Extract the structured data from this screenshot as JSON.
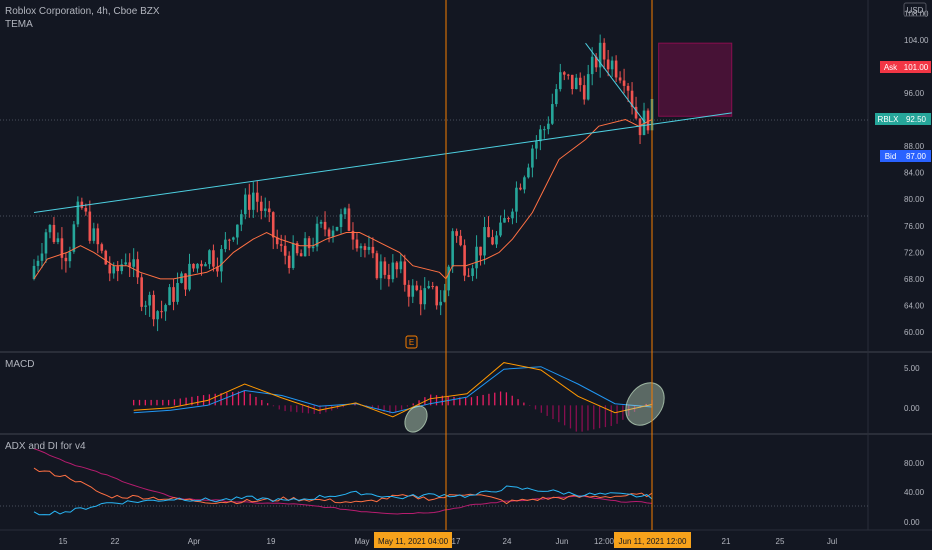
{
  "header": {
    "symbol": "Roblox Corporation, 4h, Cboe BZX",
    "indicator": "TEMA",
    "currency_badge": "USD"
  },
  "price_axis": {
    "ticks": [
      "108.00",
      "104.00",
      "100.00",
      "96.00",
      "92.00",
      "88.00",
      "84.00",
      "80.00",
      "76.00",
      "72.00",
      "68.00",
      "64.00",
      "60.00"
    ],
    "range": [
      57,
      110
    ]
  },
  "tags": {
    "ask": {
      "label": "Ask",
      "value": "101.00",
      "color": "#f23645"
    },
    "last": {
      "label": "RBLX",
      "value": "92.50",
      "color": "#26a69a"
    },
    "bid": {
      "label": "Bid",
      "value": "87.00",
      "color": "#2962ff"
    }
  },
  "earnings_marker": "E",
  "panes": {
    "macd": {
      "title": "MACD",
      "ticks": [
        "5.00",
        "0.00"
      ]
    },
    "adx": {
      "title": "ADX and DI for v4",
      "ticks": [
        "80.00",
        "40.00",
        "0.00"
      ]
    }
  },
  "time_axis": {
    "labels": [
      "15",
      "22",
      "Apr",
      "19",
      "May",
      "17",
      "24",
      "Jun",
      "12:00",
      "21",
      "25",
      "Jul"
    ],
    "highlight_left": "May 11, 2021   04:00",
    "highlight_right": "Jun 11, 2021   12:00"
  },
  "chart_data": {
    "type": "candlestick",
    "title": "Roblox Corporation, 4h, Cboe BZX",
    "ylim": [
      57,
      110
    ],
    "x": [
      "2021-03-10",
      "2021-03-12",
      "2021-03-15",
      "2021-03-17",
      "2021-03-19",
      "2021-03-22",
      "2021-03-24",
      "2021-03-26",
      "2021-03-29",
      "2021-03-31",
      "2021-04-05",
      "2021-04-07",
      "2021-04-09",
      "2021-04-12",
      "2021-04-14",
      "2021-04-16",
      "2021-04-19",
      "2021-04-21",
      "2021-04-23",
      "2021-04-26",
      "2021-04-28",
      "2021-04-30",
      "2021-05-04",
      "2021-05-06",
      "2021-05-10",
      "2021-05-11",
      "2021-05-12",
      "2021-05-14",
      "2021-05-17",
      "2021-05-19",
      "2021-05-21",
      "2021-05-24",
      "2021-05-26",
      "2021-05-28",
      "2021-06-01",
      "2021-06-03",
      "2021-06-07",
      "2021-06-09",
      "2021-06-11"
    ],
    "close": [
      70,
      76,
      72,
      79,
      74,
      68,
      72,
      66,
      63,
      66,
      72,
      71,
      76,
      81,
      77,
      72,
      71,
      74,
      76,
      77,
      74,
      70,
      69,
      66,
      65,
      66,
      76,
      70,
      74,
      74,
      80,
      88,
      91,
      98,
      97,
      102,
      99,
      91,
      93
    ],
    "series": [
      {
        "name": "TEMA",
        "values": [
          68,
          71,
          72,
          73,
          72,
          70,
          70,
          69,
          68,
          68,
          69,
          70,
          72,
          74,
          75,
          74,
          73,
          73,
          74,
          75,
          75,
          74,
          72,
          70,
          69,
          68,
          70,
          70,
          71,
          72,
          74,
          78,
          82,
          86,
          89,
          91,
          92,
          91,
          92
        ]
      }
    ],
    "annotations": [
      {
        "type": "trendline",
        "from": [
          "2021-03-10",
          78
        ],
        "to": [
          "2021-06-23",
          93
        ]
      },
      {
        "type": "box",
        "x_range": [
          "2021-06-12",
          "2021-06-23"
        ],
        "y_range": [
          92.5,
          103.5
        ]
      },
      {
        "type": "vline",
        "x": "2021-05-11",
        "label": "May 11, 2021   04:00"
      },
      {
        "type": "vline",
        "x": "2021-06-11",
        "label": "Jun 11, 2021   12:00"
      }
    ],
    "macd": {
      "ylim": [
        -3,
        6
      ],
      "x_range": [
        "2021-03-25",
        "2021-06-11"
      ],
      "macd": [
        -0.6,
        -0.3,
        0.6,
        2.6,
        0.9,
        -0.6,
        0.3,
        -1.4,
        0.8,
        1.4,
        5.2,
        4.3,
        1.1,
        -0.9,
        0.1
      ],
      "signal": [
        -0.9,
        -0.6,
        0.0,
        1.8,
        1.2,
        -0.1,
        0.2,
        -0.9,
        0.2,
        1.0,
        4.4,
        4.7,
        2.6,
        0.2,
        -0.2
      ]
    },
    "adx": {
      "ylim": [
        -5,
        100
      ],
      "x_range": [
        "2021-03-10",
        "2021-06-11"
      ],
      "adx": [
        90,
        72,
        58,
        42,
        30,
        28,
        25,
        24,
        20,
        15,
        12,
        14,
        22,
        27,
        30,
        33,
        27,
        25
      ],
      "di_plus": [
        12,
        15,
        25,
        27,
        30,
        28,
        31,
        27,
        33,
        37,
        31,
        35,
        33,
        43,
        40,
        35,
        35,
        32
      ],
      "di_minus": [
        65,
        55,
        33,
        32,
        29,
        26,
        27,
        30,
        28,
        25,
        33,
        30,
        37,
        26,
        30,
        32,
        33,
        35
      ]
    }
  }
}
